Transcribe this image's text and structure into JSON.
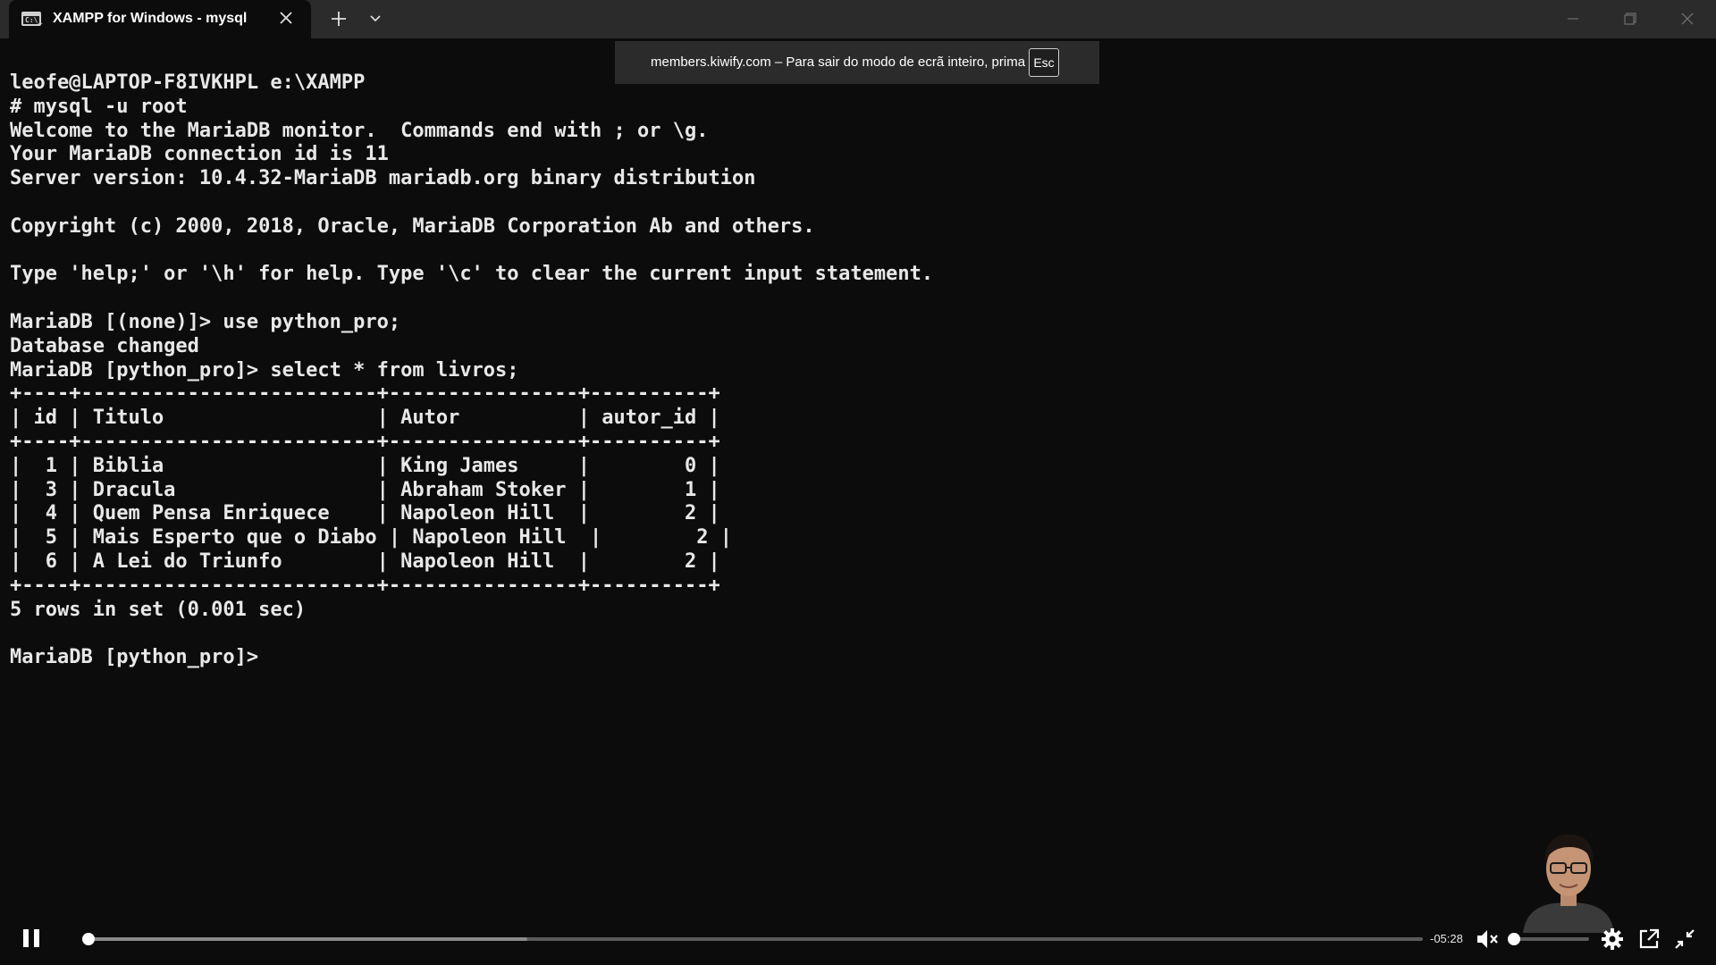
{
  "window": {
    "tab_title": "XAMPP for Windows - mysql",
    "tab_icon_text": "C:\\_"
  },
  "fullscreen_notice": {
    "message": "members.kiwify.com – Para sair do modo de ecrã inteiro, prima",
    "key_label": "Esc"
  },
  "terminal": {
    "lines": [
      "leofe@LAPTOP-F8IVKHPL e:\\XAMPP",
      "# mysql -u root",
      "Welcome to the MariaDB monitor.  Commands end with ; or \\g.",
      "Your MariaDB connection id is 11",
      "Server version: 10.4.32-MariaDB mariadb.org binary distribution",
      "",
      "Copyright (c) 2000, 2018, Oracle, MariaDB Corporation Ab and others.",
      "",
      "Type 'help;' or '\\h' for help. Type '\\c' to clear the current input statement.",
      "",
      "MariaDB [(none)]> use python_pro;",
      "Database changed",
      "MariaDB [python_pro]> select * from livros;",
      "+----+-------------------------+----------------+----------+",
      "| id | Titulo                  | Autor          | autor_id |",
      "+----+-------------------------+----------------+----------+",
      "|  1 | Biblia                  | King James     |        0 |",
      "|  3 | Dracula                 | Abraham Stoker |        1 |",
      "|  4 | Quem Pensa Enriquece    | Napoleon Hill  |        2 |",
      "|  5 | Mais Esperto que o Diabo | Napoleon Hill  |        2 |",
      "|  6 | A Lei do Triunfo        | Napoleon Hill  |        2 |",
      "+----+-------------------------+----------------+----------+",
      "5 rows in set (0.001 sec)",
      "",
      "MariaDB [python_pro]>"
    ]
  },
  "player": {
    "time_remaining": "-05:28",
    "progress_fraction": 0.002,
    "buffered_fraction": 0.33,
    "volume_fraction": 0.0,
    "muted": true,
    "state": "playing"
  },
  "icons": {
    "play_pause": "pause-icon",
    "mute": "volume-muted-icon",
    "settings": "gear-icon",
    "popout": "external-link-icon",
    "exit_fullscreen": "exit-fullscreen-icon"
  }
}
